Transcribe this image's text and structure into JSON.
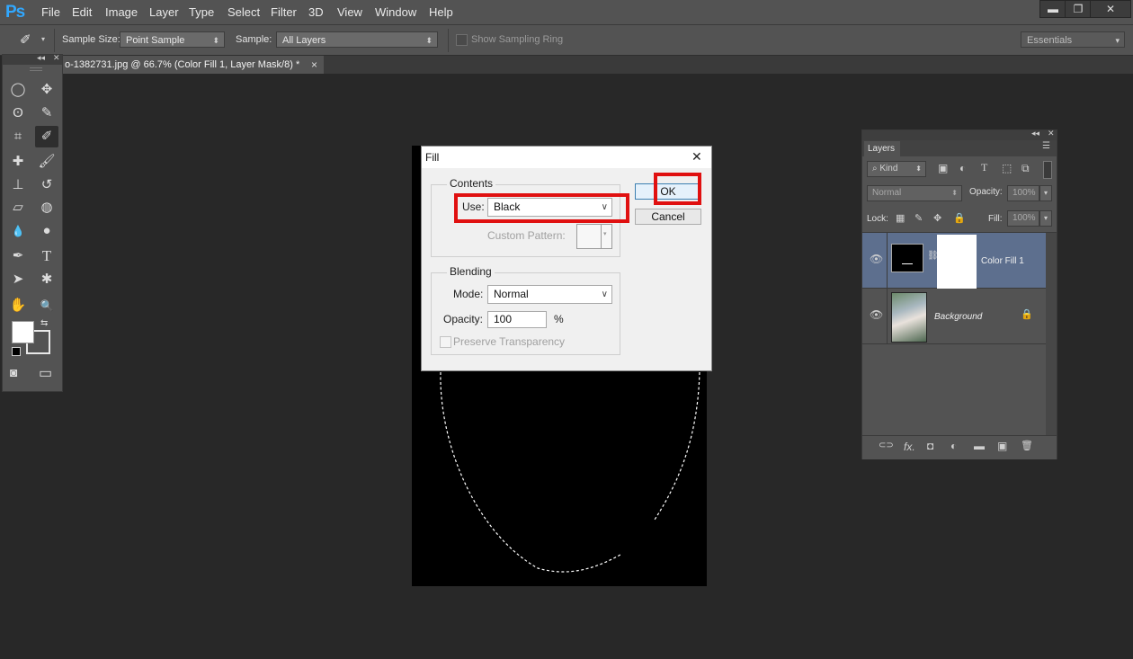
{
  "app": {
    "logo": "Ps"
  },
  "menu": [
    "File",
    "Edit",
    "Image",
    "Layer",
    "Type",
    "Select",
    "Filter",
    "3D",
    "View",
    "Window",
    "Help"
  ],
  "window_controls": {
    "minimize": "▬",
    "restore": "❐",
    "close": "✕"
  },
  "options_bar": {
    "sample_size_label": "Sample Size:",
    "sample_size_value": "Point Sample",
    "sample_label": "Sample:",
    "sample_value": "All Layers",
    "show_sampling_ring": "Show Sampling Ring",
    "workspace": "Essentials"
  },
  "document": {
    "tab_title": "o-1382731.jpg @ 66.7% (Color Fill 1, Layer Mask/8) *",
    "tab_close": "×"
  },
  "toolbox": {
    "tools": [
      {
        "name": "elliptical-marquee-icon",
        "glyph": "◯"
      },
      {
        "name": "move-icon",
        "glyph": "✥"
      },
      {
        "name": "lasso-icon",
        "glyph": "ʘ"
      },
      {
        "name": "quick-selection-icon",
        "glyph": "✎"
      },
      {
        "name": "crop-icon",
        "glyph": "⌗"
      },
      {
        "name": "eyedropper-icon",
        "glyph": "✐"
      },
      {
        "name": "spot-healing-icon",
        "glyph": "✚"
      },
      {
        "name": "brush-icon",
        "glyph": "🖌"
      },
      {
        "name": "clone-stamp-icon",
        "glyph": "⊥"
      },
      {
        "name": "history-brush-icon",
        "glyph": "↺"
      },
      {
        "name": "eraser-icon",
        "glyph": "▱"
      },
      {
        "name": "paint-bucket-icon",
        "glyph": "◍"
      },
      {
        "name": "blur-icon",
        "glyph": "💧"
      },
      {
        "name": "dodge-icon",
        "glyph": "●"
      },
      {
        "name": "pen-icon",
        "glyph": "✒"
      },
      {
        "name": "type-icon",
        "glyph": "T"
      },
      {
        "name": "path-selection-icon",
        "glyph": "➤"
      },
      {
        "name": "custom-shape-icon",
        "glyph": "✱"
      },
      {
        "name": "hand-icon",
        "glyph": "✋"
      },
      {
        "name": "zoom-icon",
        "glyph": "🔍"
      }
    ],
    "swap_glyph": "⇆",
    "quick_mask_glyph": "◙",
    "screen_mode_glyph": "▭"
  },
  "fill_dialog": {
    "title": "Fill",
    "close": "✕",
    "contents_legend": "Contents",
    "use_label": "Use:",
    "use_value": "Black",
    "custom_pattern_label": "Custom Pattern:",
    "blending_legend": "Blending",
    "mode_label": "Mode:",
    "mode_value": "Normal",
    "opacity_label": "Opacity:",
    "opacity_value": "100",
    "opacity_unit": "%",
    "preserve_transparency": "Preserve Transparency",
    "ok": "OK",
    "cancel": "Cancel",
    "chevron": "∨"
  },
  "layers_panel": {
    "tab": "Layers",
    "kind_value": "Kind",
    "blend_mode": "Normal",
    "opacity_label": "Opacity:",
    "opacity_value": "100%",
    "lock_label": "Lock:",
    "fill_label": "Fill:",
    "fill_value": "100%",
    "layers": [
      {
        "name": "Color Fill 1",
        "selected": true
      },
      {
        "name": "Background",
        "selected": false,
        "locked": true
      }
    ],
    "footer_icons": [
      "link-icon",
      "fx-icon",
      "mask-icon",
      "adjustment-icon",
      "folder-icon",
      "new-layer-icon",
      "trash-icon"
    ],
    "footer_glyphs": [
      "⊂⊃",
      "fx.",
      "◘",
      "◐",
      "▬",
      "▣",
      "🗑"
    ]
  },
  "colors": {
    "accent": "#31a8ff",
    "highlight_red": "#e01010",
    "selected_layer": "#5d6f8e"
  }
}
